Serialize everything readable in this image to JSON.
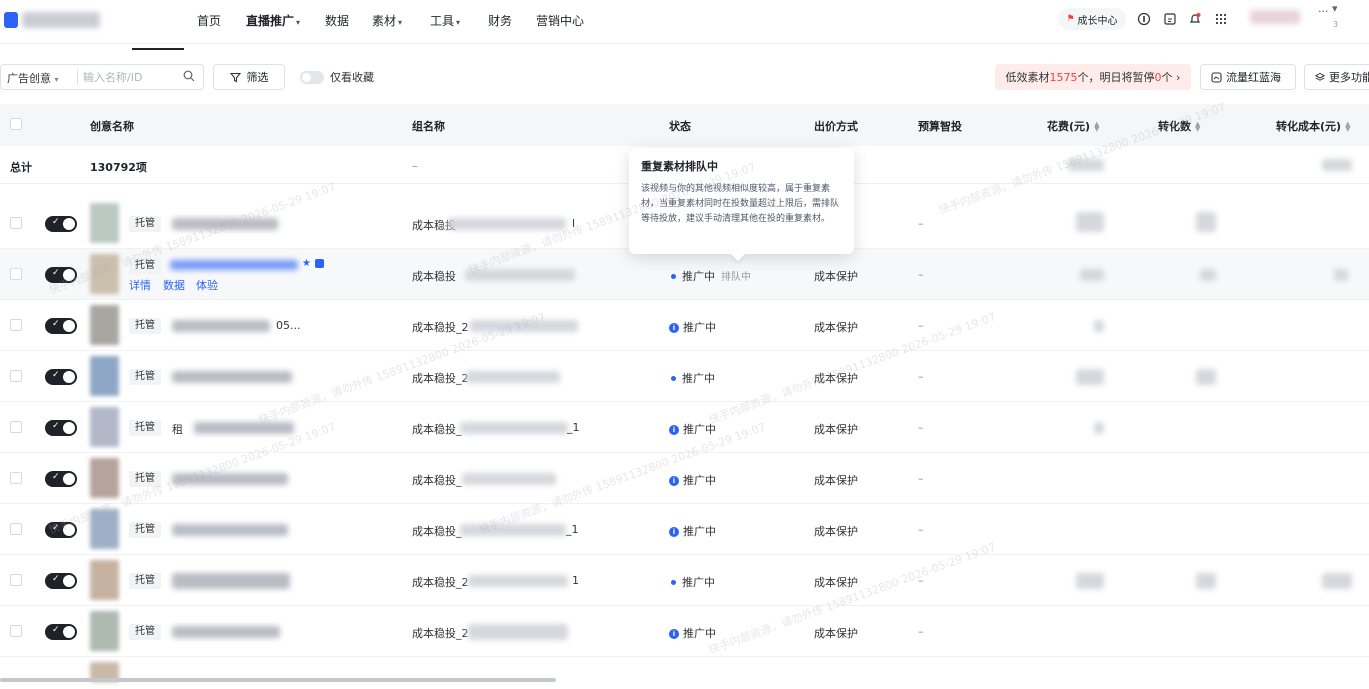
{
  "nav": {
    "items": [
      {
        "label": "首页",
        "has_caret": false,
        "active": false
      },
      {
        "label": "直播推广",
        "has_caret": true,
        "active": true
      },
      {
        "label": "数据",
        "has_caret": false,
        "active": false
      },
      {
        "label": "素材",
        "has_caret": true,
        "active": false
      },
      {
        "label": "工具",
        "has_caret": true,
        "active": false
      },
      {
        "label": "财务",
        "has_caret": false,
        "active": false
      },
      {
        "label": "营销中心",
        "has_caret": false,
        "active": false
      }
    ],
    "growth_center": "成长中心",
    "more_dots": "...",
    "notification_count": "3"
  },
  "filters": {
    "ad_type_select": "广告创意",
    "search_placeholder": "输入名称/ID",
    "filter_button": "筛选",
    "favorites_toggle": "仅看收藏",
    "low_banner_prefix": "低效素材",
    "low_banner_count1": "1575",
    "low_banner_mid": "个，明日将暂停",
    "low_banner_count2": "0",
    "low_banner_suffix": "个 ›",
    "traffic_button": "流量红蓝海",
    "more_button": "更多功能"
  },
  "table": {
    "columns": {
      "name": "创意名称",
      "group": "组名称",
      "status": "状态",
      "bid": "出价方式",
      "budget": "预算智投",
      "cost": "花费(元)",
      "conversions": "转化数",
      "conv_cost": "转化成本(元)"
    },
    "summary": {
      "label": "总计",
      "count": "130792项",
      "group_dash": "–"
    },
    "rows": [
      {
        "tag": "托管",
        "group": "成本稳投",
        "group_suffix": "l",
        "status": "",
        "status_type": "none",
        "bid": "",
        "budget": "–"
      },
      {
        "tag": "托管",
        "group": "成本稳投",
        "group_suffix": "",
        "status": "推广中",
        "status_type": "dot",
        "queue": "排队中",
        "bid": "成本保护",
        "budget": "–",
        "links": [
          "详情",
          "数据",
          "体验"
        ]
      },
      {
        "tag": "托管",
        "name_suffix": "05...",
        "group": "成本稳投_2",
        "group_suffix": "",
        "status": "推广中",
        "status_type": "info",
        "bid": "成本保护",
        "budget": "–"
      },
      {
        "tag": "托管",
        "group": "成本稳投_2",
        "group_suffix": "",
        "status": "推广中",
        "status_type": "dot",
        "bid": "成本保护",
        "budget": "–"
      },
      {
        "tag": "托管",
        "name_prefix": "租",
        "group": "成本稳投_",
        "group_suffix": "_1",
        "status": "推广中",
        "status_type": "info",
        "bid": "成本保护",
        "budget": "–"
      },
      {
        "tag": "托管",
        "group": "成本稳投_",
        "group_suffix": "",
        "status": "推广中",
        "status_type": "info",
        "bid": "成本保护",
        "budget": "–"
      },
      {
        "tag": "托管",
        "group": "成本稳投_",
        "group_suffix": "_1",
        "status": "推广中",
        "status_type": "info",
        "bid": "成本保护",
        "budget": "–"
      },
      {
        "tag": "托管",
        "group": "成本稳投_2",
        "group_suffix": "1",
        "status": "推广中",
        "status_type": "dot",
        "bid": "成本保护",
        "budget": "–"
      },
      {
        "tag": "托管",
        "group": "成本稳投_2",
        "group_suffix": "",
        "status": "推广中",
        "status_type": "info",
        "bid": "成本保护",
        "budget": "–"
      }
    ]
  },
  "tooltip": {
    "title": "重复素材排队中",
    "body": "该视频与你的其他视频相似度较高，属于重复素材，当重复素材同时在投数量超过上限后，需排队等待投放，建议手动清理其他在投的重复素材。"
  },
  "watermark": "快手内部资源，请勿外传 15891132800 2026-05-29 19:07",
  "colors": {
    "accent": "#2a63f6",
    "alert": "#f53f3f",
    "banner_bg": "#fdecea"
  }
}
